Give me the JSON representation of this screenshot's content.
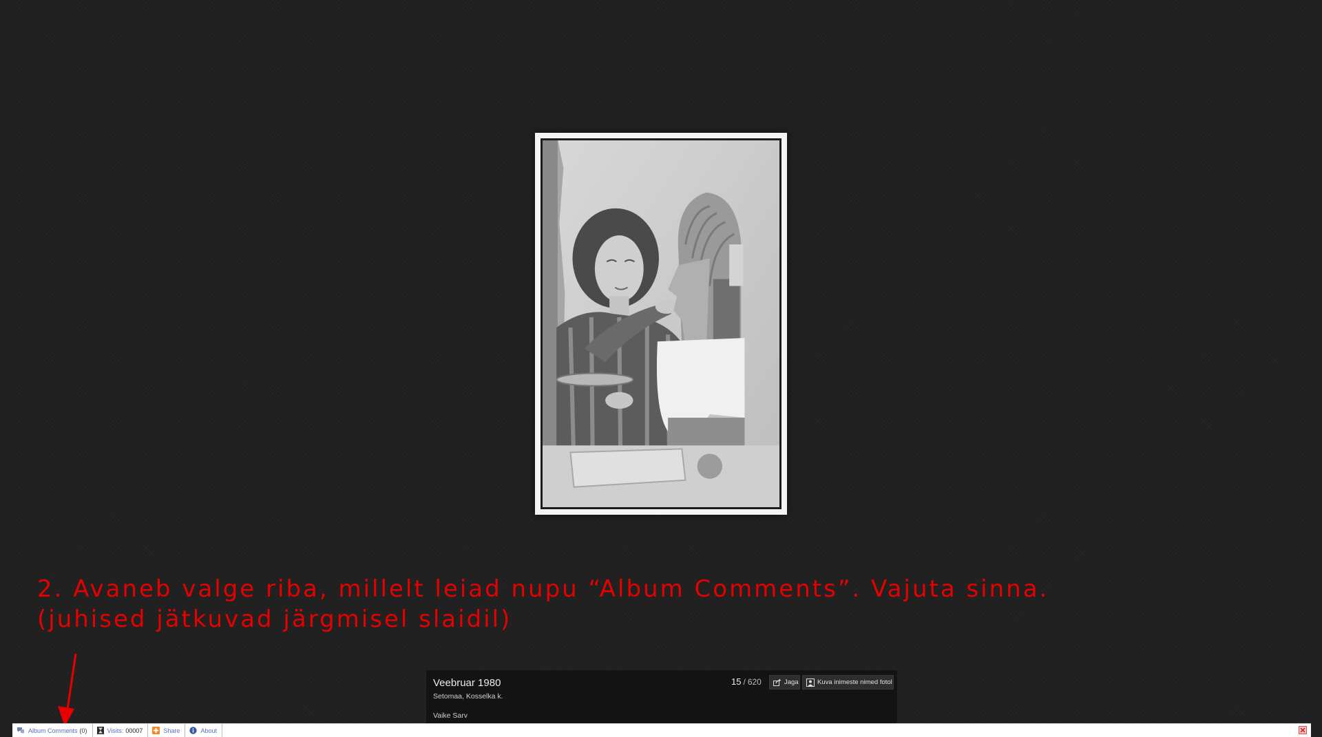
{
  "instruction": {
    "line1": "2. Avaneb valge riba, millelt leiad nupu “Album Comments”. Vajuta sinna.",
    "line2": "(juhised jätkuvad järgmisel slaidil)"
  },
  "caption": {
    "title": "Veebruar 1980",
    "location": "Setomaa, Kosselka k.",
    "author": "Vaike Sarv",
    "counter_current": "15",
    "counter_separator": "/",
    "counter_total": "620",
    "share_label": "Jaga",
    "names_label": "Kuva inimeste nimed fotol"
  },
  "toolbar": {
    "album_comments_label": "Album Comments",
    "album_comments_count": "(0)",
    "visits_label": "Visits:",
    "visits_value": "00007",
    "share_label": "Share",
    "about_label": "About"
  },
  "colors": {
    "background": "#212121",
    "annotation": "#e60000",
    "caption_panel": "#131313",
    "toolbar_link": "#5570b8"
  }
}
